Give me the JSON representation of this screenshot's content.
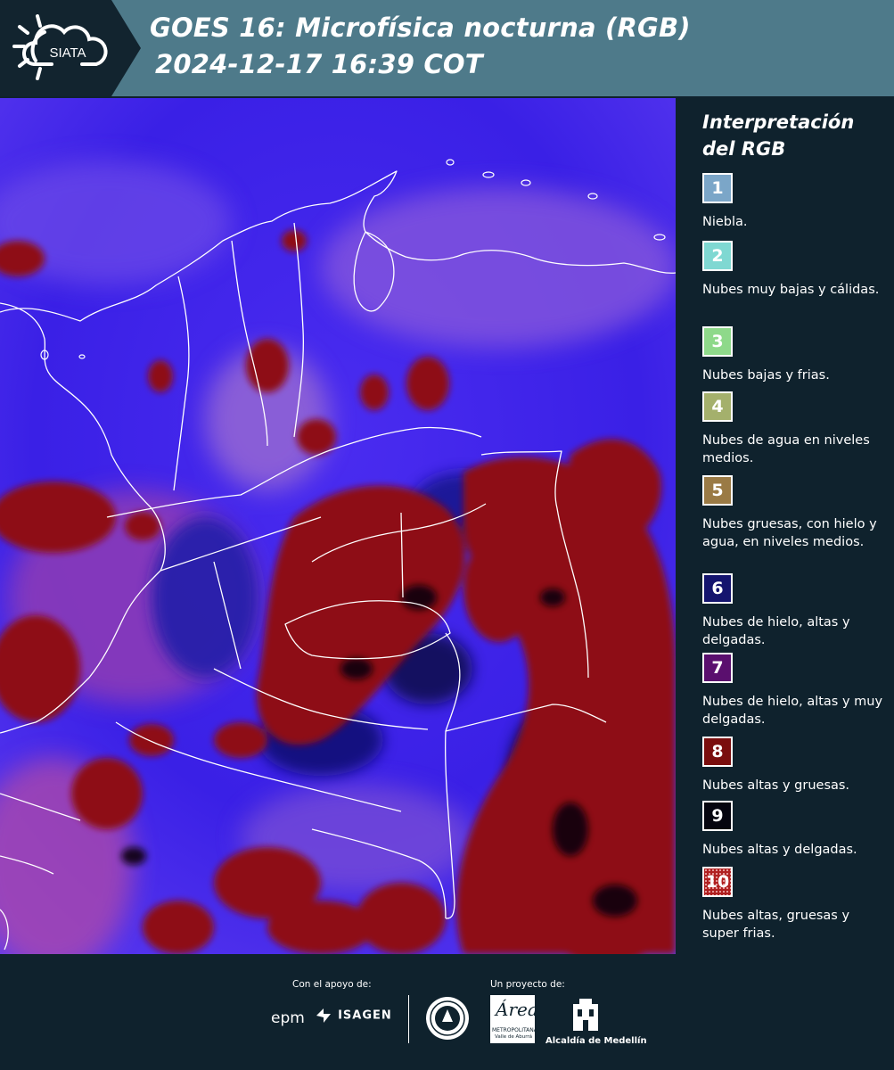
{
  "header": {
    "logo_text": "SIATA",
    "title_line1": "GOES 16: Microfísica nocturna (RGB)",
    "title_line2": "2024-12-17 16:39 COT"
  },
  "legend": {
    "title_line1": "Interpretación",
    "title_line2": "del RGB",
    "items": [
      {
        "number": "1",
        "label": "Niebla.",
        "color": "#7ba6c8"
      },
      {
        "number": "2",
        "label": "Nubes muy bajas y cálidas.",
        "color": "#7fd8d2"
      },
      {
        "number": "3",
        "label": "Nubes bajas y frias.",
        "color": "#8ed98a"
      },
      {
        "number": "4",
        "label": "Nubes de agua en niveles medios.",
        "color": "#a4b06c"
      },
      {
        "number": "5",
        "label": "Nubes gruesas, con hielo y agua, en niveles medios.",
        "color": "#9a7a45"
      },
      {
        "number": "6",
        "label": "Nubes de hielo, altas y delgadas.",
        "color": "#14146e"
      },
      {
        "number": "7",
        "label": "Nubes de hielo, altas y muy delgadas.",
        "color": "#5a0f6e"
      },
      {
        "number": "8",
        "label": "Nubes altas y gruesas.",
        "color": "#7a0e0e"
      },
      {
        "number": "9",
        "label": "Nubes altas y delgadas.",
        "color": "#05050f"
      },
      {
        "number": "10",
        "label": "Nubes altas, gruesas y super frias.",
        "color": "#b02020"
      }
    ]
  },
  "footer": {
    "support_label": "Con el apoyo de:",
    "project_label": "Un proyecto de:",
    "epm_logo": "epm",
    "isagen_logo": "ISAGEN",
    "area_logo_main": "Área",
    "area_logo_sub": "METROPOLITANA",
    "area_logo_sub2": "Valle de Aburrá",
    "alcaldia_logo": "Alcaldía de Medellín"
  },
  "icons": {
    "logo": "sun-cloud-icon",
    "seal": "medellin-seal-icon",
    "isagen": "isagen-icon",
    "alcaldia": "alcaldia-building-icon"
  }
}
